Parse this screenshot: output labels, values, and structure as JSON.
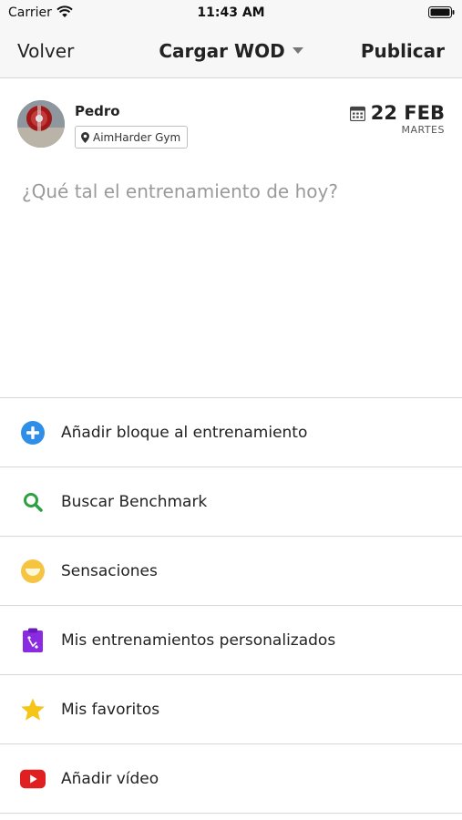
{
  "status_bar": {
    "carrier": "Carrier",
    "time": "11:43 AM"
  },
  "nav": {
    "back_label": "Volver",
    "title": "Cargar WOD",
    "publish_label": "Publicar"
  },
  "post": {
    "user_name": "Pedro",
    "gym": "AimHarder Gym",
    "date": "22 FEB",
    "weekday": "MARTES",
    "placeholder": "¿Qué tal el entrenamiento de hoy?"
  },
  "options": [
    {
      "label": "Añadir bloque al entrenamiento",
      "icon": "add-circle-icon",
      "color": "#2f8fe8"
    },
    {
      "label": "Buscar Benchmark",
      "icon": "search-icon",
      "color": "#2ea043"
    },
    {
      "label": "Sensaciones",
      "icon": "smiley-icon",
      "color": "#f5c542"
    },
    {
      "label": "Mis entrenamientos personalizados",
      "icon": "clipboard-icon",
      "color": "#8a2be2"
    },
    {
      "label": "Mis favoritos",
      "icon": "star-icon",
      "color": "#f5c518"
    },
    {
      "label": "Añadir vídeo",
      "icon": "youtube-icon",
      "color": "#e02020"
    }
  ]
}
